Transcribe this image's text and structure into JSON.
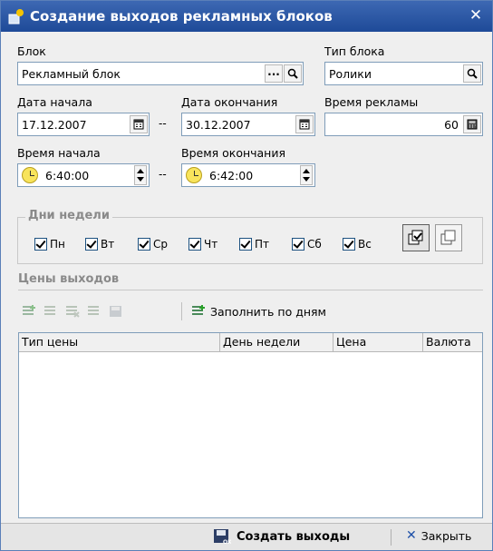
{
  "window": {
    "title": "Создание выходов рекламных блоков",
    "close_icon": "close-icon"
  },
  "block": {
    "label": "Блок",
    "value": "Рекламный блок",
    "ellipsis": "..."
  },
  "block_type": {
    "label": "Тип блока",
    "value": "Ролики"
  },
  "date_start": {
    "label": "Дата начала",
    "value": "17.12.2007"
  },
  "date_end": {
    "label": "Дата окончания",
    "value": "30.12.2007"
  },
  "ad_time": {
    "label": "Время рекламы",
    "value": "60"
  },
  "time_start": {
    "label": "Время начала",
    "value": "6:40:00"
  },
  "time_end": {
    "label": "Время окончания",
    "value": "6:42:00"
  },
  "range_separator": "--",
  "weekdays": {
    "legend": "Дни недели",
    "days": [
      {
        "label": "Пн",
        "checked": true
      },
      {
        "label": "Вт",
        "checked": true
      },
      {
        "label": "Ср",
        "checked": true
      },
      {
        "label": "Чт",
        "checked": true
      },
      {
        "label": "Пт",
        "checked": true
      },
      {
        "label": "Сб",
        "checked": true
      },
      {
        "label": "Вс",
        "checked": true
      }
    ]
  },
  "prices": {
    "section_title": "Цены выходов",
    "fill_by_days": "Заполнить по дням",
    "columns": [
      "Тип цены",
      "День недели",
      "Цена",
      "Валюта"
    ],
    "rows": []
  },
  "footer": {
    "create": "Создать выходы",
    "close": "Закрыть"
  },
  "colors": {
    "titlebar": "#2a58a6",
    "accent": "#1e50a8"
  }
}
